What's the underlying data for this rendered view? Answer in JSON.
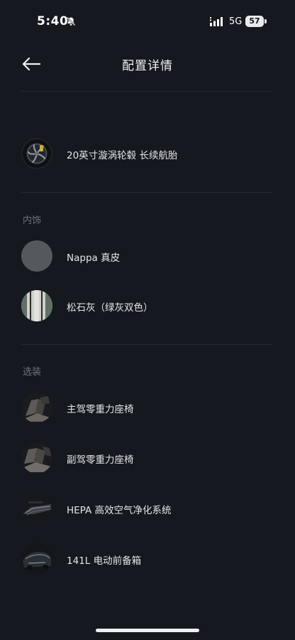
{
  "status_bar": {
    "time": "5:40",
    "network": "5G",
    "battery": "57"
  },
  "header": {
    "title": "配置详情"
  },
  "sections": {
    "interior": {
      "label": "内饰"
    },
    "options": {
      "label": "选装"
    }
  },
  "items": {
    "wheel": {
      "label": "20英寸漩涡轮毂 长续航胎",
      "icon": "wheel-icon"
    },
    "nappa": {
      "label": "Nappa 真皮",
      "icon": "leather-swatch"
    },
    "color": {
      "label": "松石灰（绿灰双色）",
      "icon": "color-swatch"
    },
    "driver_seat": {
      "label": "主驾零重力座椅",
      "icon": "seat-thumbnail"
    },
    "passenger_seat": {
      "label": "副驾零重力座椅",
      "icon": "seat-thumbnail"
    },
    "hepa": {
      "label": "HEPA 高效空气净化系统",
      "icon": "air-filter-thumbnail"
    },
    "frunk": {
      "label": "141L 电动前备箱",
      "icon": "car-front-thumbnail"
    }
  },
  "colors": {
    "background": "#15181e",
    "text": "#e4e6ea",
    "section_label": "#6e7380",
    "divider": "#262a32"
  }
}
